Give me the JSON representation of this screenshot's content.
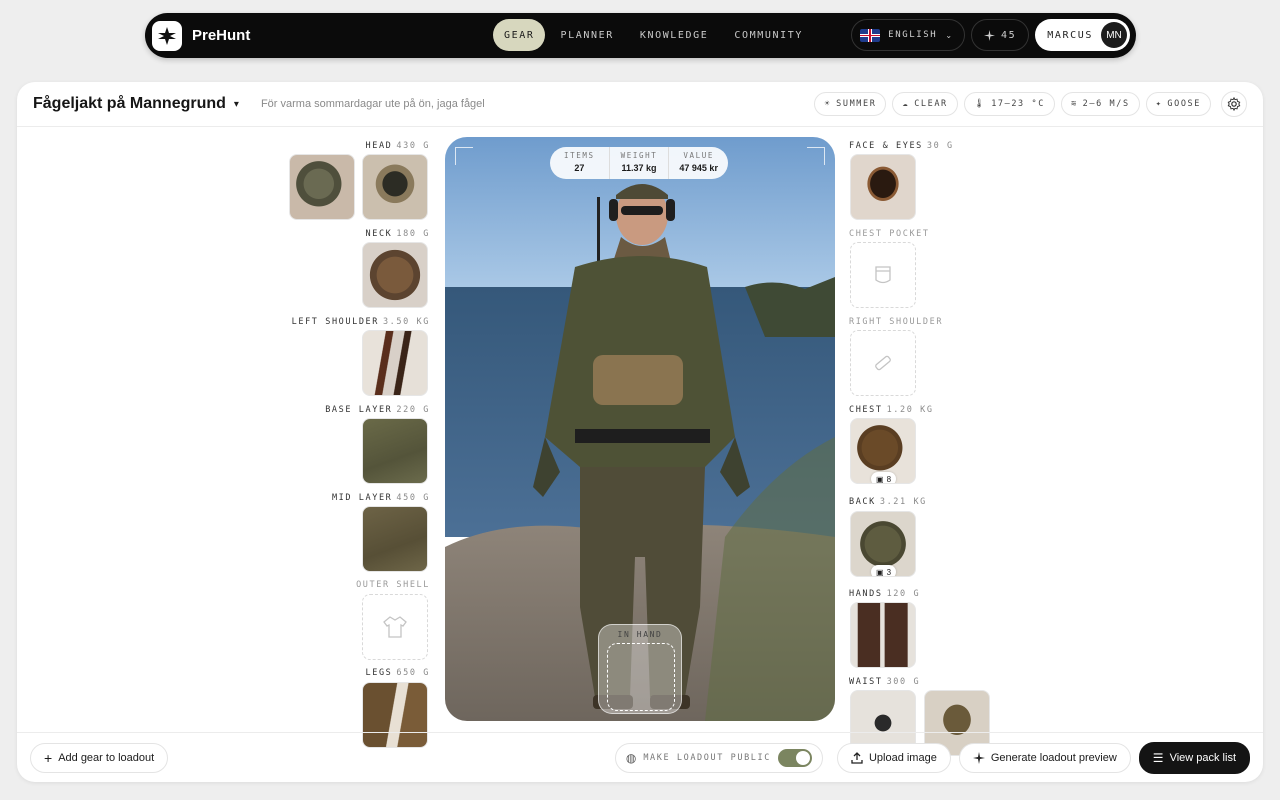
{
  "nav": {
    "brand": "PreHunt",
    "links": [
      "GEAR",
      "PLANNER",
      "KNOWLEDGE",
      "COMMUNITY"
    ],
    "language": "ENGLISH",
    "streak": "45",
    "user": "MARCUS",
    "initials": "MN"
  },
  "loadout": {
    "title": "Fågeljakt på Mannegrund",
    "description": "För varma sommardagar ute på ön, jaga fågel"
  },
  "conditions": {
    "season": "SUMMER",
    "weather": "CLEAR",
    "temperature": "17–23 °C",
    "wind": "2–6 m/s",
    "game": "GOOSE"
  },
  "stats": {
    "items_label": "ITEMS",
    "items": "27",
    "weight_label": "WEIGHT",
    "weight": "11.37 kg",
    "value_label": "VALUE",
    "value": "47 945 kr"
  },
  "in_hand": "IN HAND",
  "slots_left": [
    {
      "name": "HEAD",
      "weight": "430 g"
    },
    {
      "name": "NECK",
      "weight": "180 g"
    },
    {
      "name": "LEFT SHOULDER",
      "weight": "3.50 kg"
    },
    {
      "name": "BASE LAYER",
      "weight": "220 g"
    },
    {
      "name": "MID LAYER",
      "weight": "450 g"
    },
    {
      "name": "OUTER SHELL",
      "weight": ""
    },
    {
      "name": "LEGS",
      "weight": "650 g"
    }
  ],
  "slots_right": [
    {
      "name": "FACE & EYES",
      "weight": "30 g"
    },
    {
      "name": "CHEST POCKET",
      "weight": ""
    },
    {
      "name": "RIGHT SHOULDER",
      "weight": ""
    },
    {
      "name": "CHEST",
      "weight": "1.20 kg",
      "badge": "8"
    },
    {
      "name": "BACK",
      "weight": "3.21 kg",
      "badge": "3"
    },
    {
      "name": "HANDS",
      "weight": "120 g"
    },
    {
      "name": "WAIST",
      "weight": "300 g"
    }
  ],
  "bottom": {
    "add_gear": "Add gear to loadout",
    "make_public": "MAKE LOADOUT PUBLIC",
    "upload": "Upload image",
    "generate": "Generate loadout preview",
    "view_pack": "View pack list"
  },
  "colors": {
    "accent_nav": "#d7d7be",
    "toggle_on": "#7b8560",
    "dark": "#141414"
  }
}
